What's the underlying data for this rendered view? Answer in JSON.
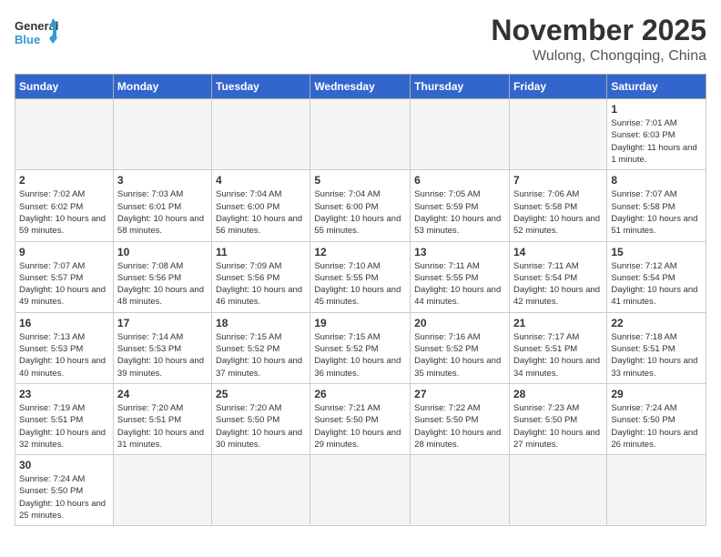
{
  "logo": {
    "text_general": "General",
    "text_blue": "Blue"
  },
  "title": "November 2025",
  "location": "Wulong, Chongqing, China",
  "days_of_week": [
    "Sunday",
    "Monday",
    "Tuesday",
    "Wednesday",
    "Thursday",
    "Friday",
    "Saturday"
  ],
  "weeks": [
    [
      {
        "day": "",
        "empty": true
      },
      {
        "day": "",
        "empty": true
      },
      {
        "day": "",
        "empty": true
      },
      {
        "day": "",
        "empty": true
      },
      {
        "day": "",
        "empty": true
      },
      {
        "day": "",
        "empty": true
      },
      {
        "day": "1",
        "sunrise": "7:01 AM",
        "sunset": "6:03 PM",
        "daylight": "11 hours and 1 minute."
      }
    ],
    [
      {
        "day": "2",
        "sunrise": "7:02 AM",
        "sunset": "6:02 PM",
        "daylight": "10 hours and 59 minutes."
      },
      {
        "day": "3",
        "sunrise": "7:03 AM",
        "sunset": "6:01 PM",
        "daylight": "10 hours and 58 minutes."
      },
      {
        "day": "4",
        "sunrise": "7:04 AM",
        "sunset": "6:00 PM",
        "daylight": "10 hours and 56 minutes."
      },
      {
        "day": "5",
        "sunrise": "7:04 AM",
        "sunset": "6:00 PM",
        "daylight": "10 hours and 55 minutes."
      },
      {
        "day": "6",
        "sunrise": "7:05 AM",
        "sunset": "5:59 PM",
        "daylight": "10 hours and 53 minutes."
      },
      {
        "day": "7",
        "sunrise": "7:06 AM",
        "sunset": "5:58 PM",
        "daylight": "10 hours and 52 minutes."
      },
      {
        "day": "8",
        "sunrise": "7:07 AM",
        "sunset": "5:58 PM",
        "daylight": "10 hours and 51 minutes."
      }
    ],
    [
      {
        "day": "9",
        "sunrise": "7:07 AM",
        "sunset": "5:57 PM",
        "daylight": "10 hours and 49 minutes."
      },
      {
        "day": "10",
        "sunrise": "7:08 AM",
        "sunset": "5:56 PM",
        "daylight": "10 hours and 48 minutes."
      },
      {
        "day": "11",
        "sunrise": "7:09 AM",
        "sunset": "5:56 PM",
        "daylight": "10 hours and 46 minutes."
      },
      {
        "day": "12",
        "sunrise": "7:10 AM",
        "sunset": "5:55 PM",
        "daylight": "10 hours and 45 minutes."
      },
      {
        "day": "13",
        "sunrise": "7:11 AM",
        "sunset": "5:55 PM",
        "daylight": "10 hours and 44 minutes."
      },
      {
        "day": "14",
        "sunrise": "7:11 AM",
        "sunset": "5:54 PM",
        "daylight": "10 hours and 42 minutes."
      },
      {
        "day": "15",
        "sunrise": "7:12 AM",
        "sunset": "5:54 PM",
        "daylight": "10 hours and 41 minutes."
      }
    ],
    [
      {
        "day": "16",
        "sunrise": "7:13 AM",
        "sunset": "5:53 PM",
        "daylight": "10 hours and 40 minutes."
      },
      {
        "day": "17",
        "sunrise": "7:14 AM",
        "sunset": "5:53 PM",
        "daylight": "10 hours and 39 minutes."
      },
      {
        "day": "18",
        "sunrise": "7:15 AM",
        "sunset": "5:52 PM",
        "daylight": "10 hours and 37 minutes."
      },
      {
        "day": "19",
        "sunrise": "7:15 AM",
        "sunset": "5:52 PM",
        "daylight": "10 hours and 36 minutes."
      },
      {
        "day": "20",
        "sunrise": "7:16 AM",
        "sunset": "5:52 PM",
        "daylight": "10 hours and 35 minutes."
      },
      {
        "day": "21",
        "sunrise": "7:17 AM",
        "sunset": "5:51 PM",
        "daylight": "10 hours and 34 minutes."
      },
      {
        "day": "22",
        "sunrise": "7:18 AM",
        "sunset": "5:51 PM",
        "daylight": "10 hours and 33 minutes."
      }
    ],
    [
      {
        "day": "23",
        "sunrise": "7:19 AM",
        "sunset": "5:51 PM",
        "daylight": "10 hours and 32 minutes."
      },
      {
        "day": "24",
        "sunrise": "7:20 AM",
        "sunset": "5:51 PM",
        "daylight": "10 hours and 31 minutes."
      },
      {
        "day": "25",
        "sunrise": "7:20 AM",
        "sunset": "5:50 PM",
        "daylight": "10 hours and 30 minutes."
      },
      {
        "day": "26",
        "sunrise": "7:21 AM",
        "sunset": "5:50 PM",
        "daylight": "10 hours and 29 minutes."
      },
      {
        "day": "27",
        "sunrise": "7:22 AM",
        "sunset": "5:50 PM",
        "daylight": "10 hours and 28 minutes."
      },
      {
        "day": "28",
        "sunrise": "7:23 AM",
        "sunset": "5:50 PM",
        "daylight": "10 hours and 27 minutes."
      },
      {
        "day": "29",
        "sunrise": "7:24 AM",
        "sunset": "5:50 PM",
        "daylight": "10 hours and 26 minutes."
      }
    ],
    [
      {
        "day": "30",
        "sunrise": "7:24 AM",
        "sunset": "5:50 PM",
        "daylight": "10 hours and 25 minutes."
      },
      {
        "day": "",
        "empty": true
      },
      {
        "day": "",
        "empty": true
      },
      {
        "day": "",
        "empty": true
      },
      {
        "day": "",
        "empty": true
      },
      {
        "day": "",
        "empty": true
      },
      {
        "day": "",
        "empty": true
      }
    ]
  ]
}
